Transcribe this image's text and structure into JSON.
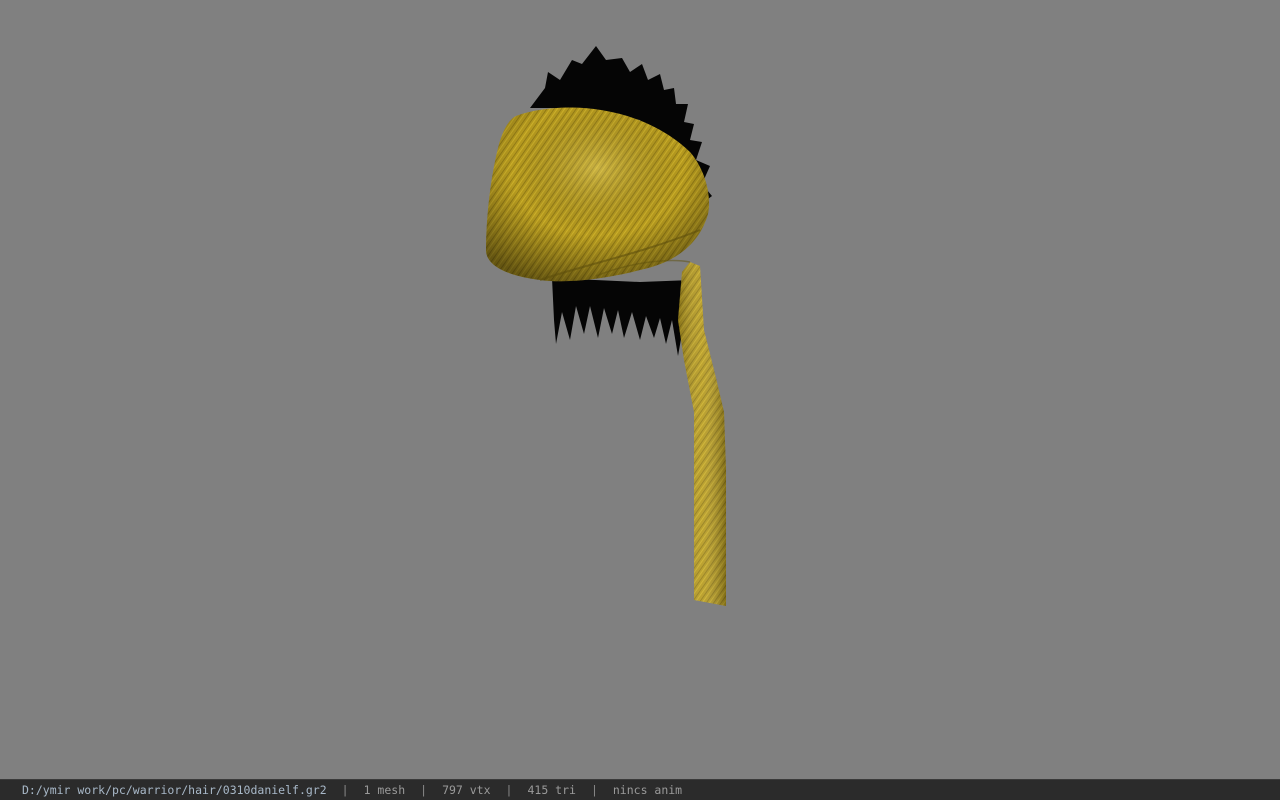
{
  "viewport": {
    "model_icon": "hair-bandana-model",
    "colors": {
      "background": "#808080",
      "cloth_main": "#b59a1e",
      "cloth_light": "#d1b52c",
      "cloth_dark": "#6d5c10",
      "hair": "#050505"
    }
  },
  "status_bar": {
    "file_path": "D:/ymir work/pc/warrior/hair/0310danielf.gr2",
    "separator": "|",
    "mesh_count": "1 mesh",
    "vertex_count": "797 vtx",
    "triangle_count": "415 tri",
    "anim": "nincs anim"
  }
}
